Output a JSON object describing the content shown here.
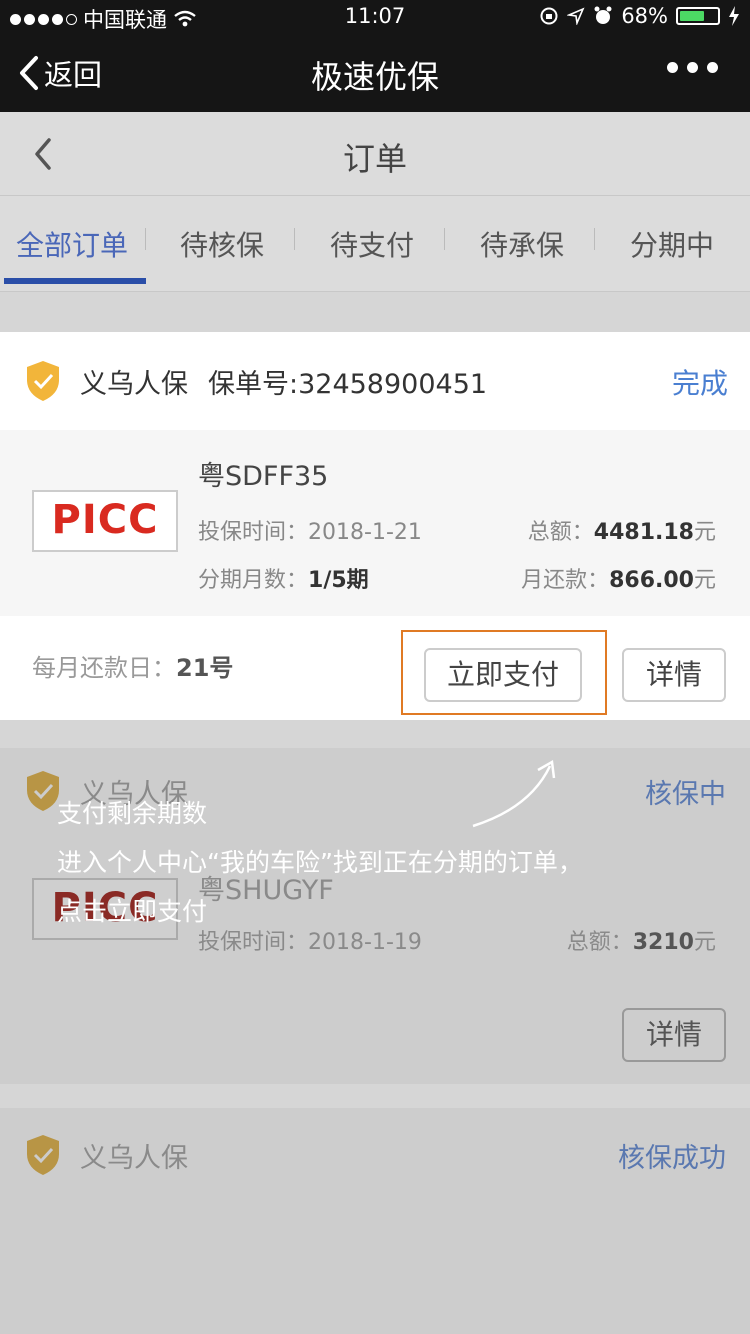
{
  "status_bar": {
    "carrier": "中国联通",
    "time": "11:07",
    "battery": "68%"
  },
  "navbar": {
    "back_label": "返回",
    "title": "极速优保"
  },
  "header": {
    "title": "订单"
  },
  "tabs": [
    {
      "label": "全部订单",
      "active": true
    },
    {
      "label": "待核保"
    },
    {
      "label": "待支付"
    },
    {
      "label": "待承保"
    },
    {
      "label": "分期中"
    }
  ],
  "orders": [
    {
      "company": "义乌人保",
      "policy_no": "保单号:32458900451",
      "status": "完成",
      "logo": "PICC",
      "plate": "粤SDFF35",
      "insure_time_label": "投保时间：",
      "insure_time": "2018-1-21",
      "total_label": "总额：",
      "total": "4481.18",
      "unit": "元",
      "installment_label": "分期月数：",
      "installment": "1/5期",
      "monthly_label": "月还款：",
      "monthly": "866.00",
      "pay_day_label": "每月还款日：",
      "pay_day": "21号",
      "pay_button": "立即支付",
      "detail_button": "详情"
    },
    {
      "company": "义乌人保",
      "status": "核保中",
      "logo": "PICC",
      "plate": "粤SHUGYF",
      "insure_time_label": "投保时间：",
      "insure_time": "2018-1-19",
      "total_label": "总额：",
      "total": "3210",
      "unit": "元",
      "detail_button": "详情"
    },
    {
      "company": "义乌人保",
      "status": "核保成功"
    }
  ],
  "tips": {
    "line1": "支付剩余期数",
    "line2": "进入个人中心“我的车险”找到正在分期的订单，",
    "line3": "点击立即支付"
  },
  "colors": {
    "accent": "#4a7fd1",
    "highlight": "#e07a24",
    "shield": "#f2b53a",
    "brand": "#d92a20"
  }
}
